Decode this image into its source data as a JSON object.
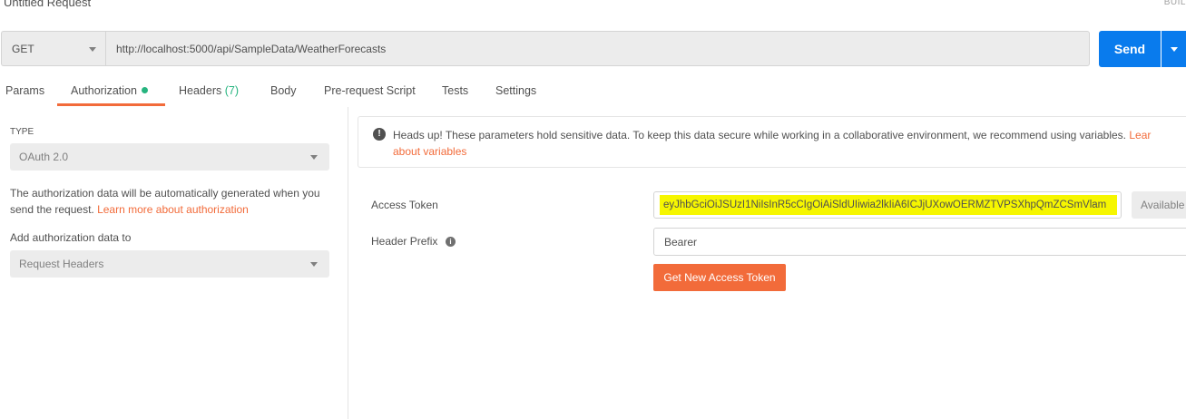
{
  "header": {
    "title": "Untitled Request",
    "build_label": "BUIL"
  },
  "request": {
    "method": "GET",
    "url": "http://localhost:5000/api/SampleData/WeatherForecasts",
    "send_label": "Send"
  },
  "tabs": [
    {
      "label": "Params"
    },
    {
      "label": "Authorization",
      "active": true,
      "indicator": "green-dot"
    },
    {
      "label": "Headers",
      "count": "(7)"
    },
    {
      "label": "Body"
    },
    {
      "label": "Pre-request Script"
    },
    {
      "label": "Tests"
    },
    {
      "label": "Settings"
    }
  ],
  "auth": {
    "type_label": "TYPE",
    "type_value": "OAuth 2.0",
    "help_text": "The authorization data will be automatically generated when you send the request.",
    "help_link": "Learn more about authorization",
    "add_to_label": "Add authorization data to",
    "add_to_value": "Request Headers"
  },
  "warning": {
    "icon": "exclamation-icon",
    "text": "Heads up! These parameters hold sensitive data. To keep this data secure while working in a collaborative environment, we recommend using variables.",
    "link_start": "Lear",
    "link_end": "about variables"
  },
  "oauth": {
    "access_token_label": "Access Token",
    "access_token_value": "eyJhbGciOiJSUzI1NiIsInR5cCIgOiAiSldUIiwia2lkIiA6ICJjUXowOERMZTVPSXhpQmZCSmVlam",
    "available_tokens_label": "Available",
    "header_prefix_label": "Header Prefix",
    "header_prefix_value": "Bearer",
    "get_token_label": "Get New Access Token"
  },
  "colors": {
    "accent": "#f26b3a",
    "send_blue": "#097bed",
    "success_green": "#26b47f",
    "highlight_yellow": "#f6f600"
  }
}
